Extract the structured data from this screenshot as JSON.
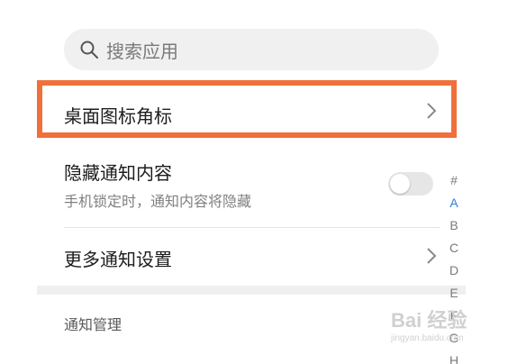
{
  "search": {
    "placeholder": "搜索应用",
    "icon": "search-icon"
  },
  "settings": {
    "badge_row": {
      "label": "桌面图标角标"
    },
    "hide_content": {
      "label": "隐藏通知内容",
      "subtitle": "手机锁定时，通知内容将隐藏",
      "enabled": false
    },
    "more_settings": {
      "label": "更多通知设置"
    }
  },
  "section": {
    "title": "通知管理"
  },
  "index_bar": {
    "letters": [
      "#",
      "A",
      "B",
      "C",
      "D",
      "E",
      "F",
      "G",
      "H"
    ],
    "active": "A"
  },
  "watermark": {
    "logo": "Bai 经验",
    "sub": "jingyan.baidu.com"
  },
  "colors": {
    "highlight": "#f0703c",
    "accent": "#2f7de1"
  }
}
